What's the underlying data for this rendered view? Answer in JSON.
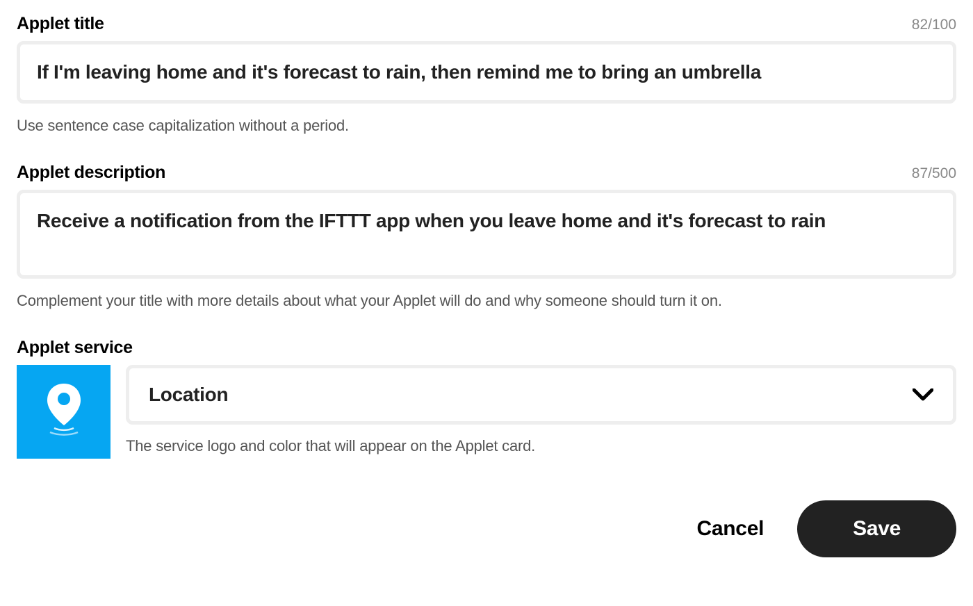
{
  "title": {
    "label": "Applet title",
    "counter": "82/100",
    "value": "If I'm leaving home and it's forecast to rain, then remind me to bring an umbrella",
    "hint": "Use sentence case capitalization without a period."
  },
  "description": {
    "label": "Applet description",
    "counter": "87/500",
    "value": "Receive a notification from the IFTTT app when you leave home and it's forecast to rain",
    "hint": "Complement your title with more details about what your Applet will do and why someone should turn it on."
  },
  "service": {
    "label": "Applet service",
    "selected": "Location",
    "hint": "The service logo and color that will appear on the Applet card.",
    "icon_color": "#06a6f2"
  },
  "buttons": {
    "cancel": "Cancel",
    "save": "Save"
  }
}
